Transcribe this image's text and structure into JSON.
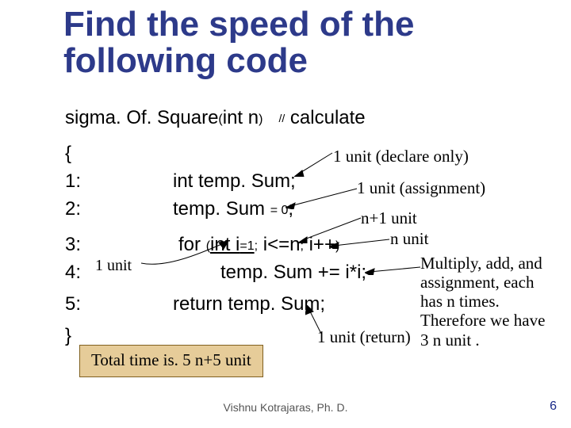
{
  "title": "Find the speed of the following code",
  "signature": {
    "func": "sigma. Of. Square",
    "open_p": "(",
    "arg": "int n",
    "close_p": ")",
    "slashes": "//",
    "comment_word": " calculate"
  },
  "lines": {
    "open_brace": "{",
    "l1_num": "1:",
    "l2_num": "2:",
    "l3_num": "3:",
    "l4_num": "4:",
    "l5_num": "5:",
    "close_brace": "}"
  },
  "code": {
    "l1": "int temp. Sum;",
    "l2_a": "temp. Sum ",
    "l2_eq": "= 0",
    "l2_b": ";",
    "l3_for": "for ",
    "l3_p1_open": "(",
    "l3_p1_body": "int i",
    "l3_p1_eq": "=1",
    "l3_sep1": ";",
    "l3_p2": " i<=n",
    "l3_sep2": ";",
    "l3_p3": " i++",
    "l3_close": ")",
    "l4": "temp. Sum += i*i;",
    "l5": "return temp. Sum;"
  },
  "notes": {
    "declare": "1 unit (declare only)",
    "assign": "1 unit (assignment)",
    "np1": "n+1 unit",
    "n": "n unit",
    "one_unit": "1 unit",
    "mul_l1": "Multiply, add, and",
    "mul_l2": "assignment, each",
    "mul_l3": "has n times.",
    "mul_l4": "Therefore we have",
    "mul_l5": "3 n unit .",
    "ret": "1 unit (return)"
  },
  "total": "Total time is. 5 n+5 unit",
  "footer": {
    "author": "Vishnu Kotrajaras, Ph. D.",
    "page": "6"
  }
}
